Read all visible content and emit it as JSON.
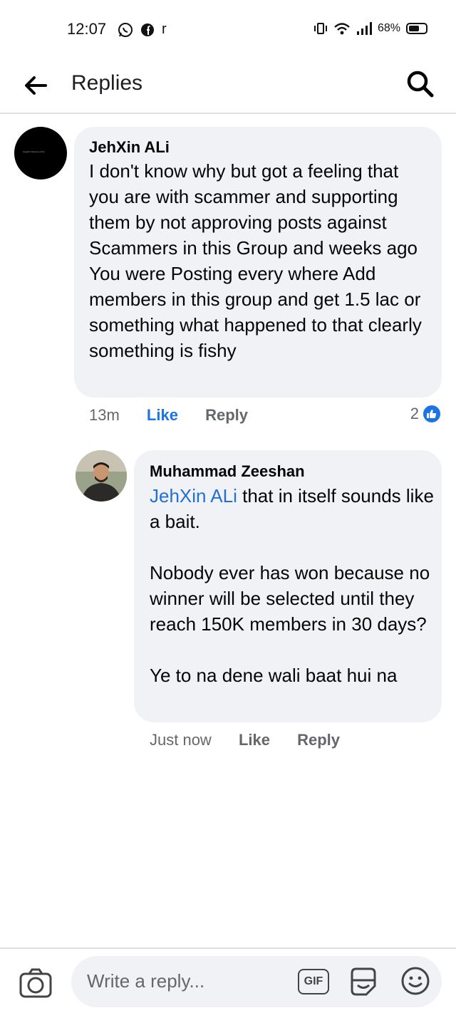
{
  "status_bar": {
    "time": "12:07",
    "carrier_letter": "r",
    "battery": "68%"
  },
  "header": {
    "title": "Replies"
  },
  "comments": [
    {
      "author": "JehXin ALi",
      "avatar_caption": "Angelic Universe of ALi",
      "text": "I don't know why but got a feeling that you are with scammer and supporting them by not approving posts against Scammers in this Group and weeks ago You were Posting every where Add members in this group and get 1.5 lac or something what happened to that clearly something is fishy",
      "time": "13m",
      "like_label": "Like",
      "reply_label": "Reply",
      "reaction_count": "2"
    },
    {
      "author": "Muhammad Zeeshan",
      "mention": "JehXin ALi",
      "text": " that in itself sounds like a bait.\n\nNobody ever has won because no winner will be selected until they reach 150K members in 30 days?\n\nYe to na dene wali baat hui na",
      "time": "Just now",
      "like_label": "Like",
      "reply_label": "Reply"
    }
  ],
  "composer": {
    "placeholder": "Write a reply...",
    "gif_label": "GIF"
  },
  "colors": {
    "accent": "#1b74e4",
    "bubble": "#f0f2f5",
    "secondary_text": "#65676b"
  }
}
